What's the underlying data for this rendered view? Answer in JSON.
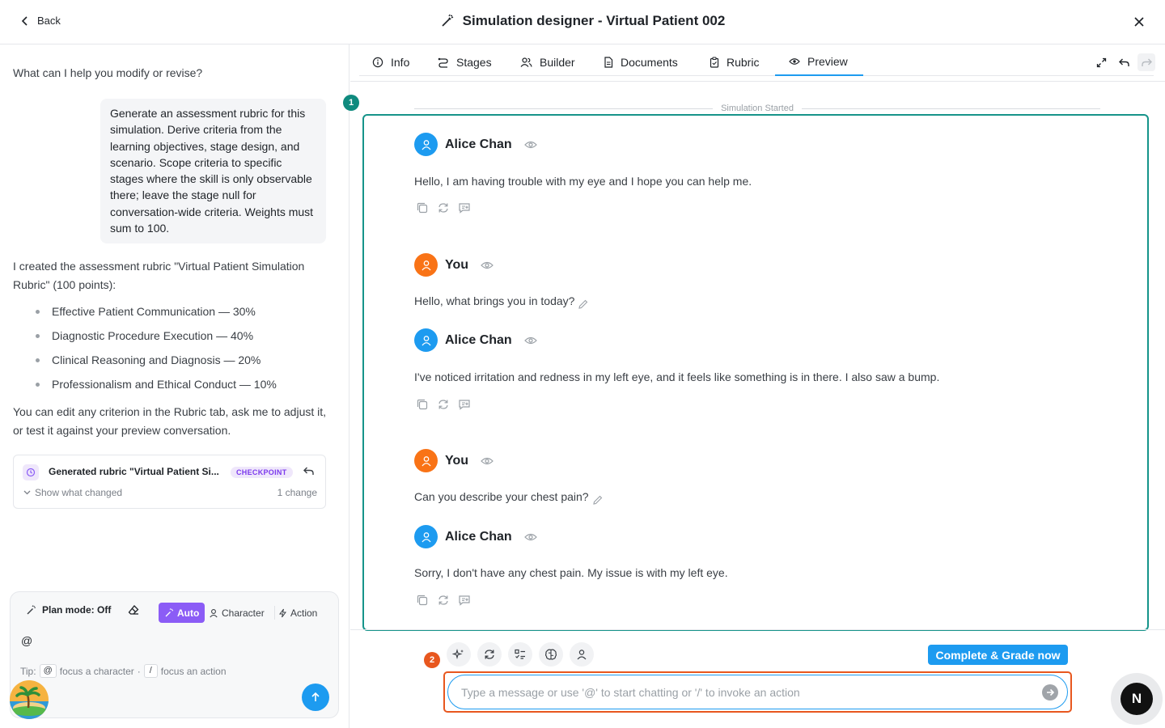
{
  "topbar": {
    "back_label": "Back",
    "title": "Simulation designer - Virtual Patient 002"
  },
  "left": {
    "question": "What can I help you modify or revise?",
    "user_prompt": "Generate an assessment rubric for this simulation. Derive criteria from the learning objectives, stage design, and scenario. Scope criteria to specific stages where the skill is only observable there; leave the stage null for conversation-wide criteria. Weights must sum to 100.",
    "reply_intro": "I created the assessment rubric \"Virtual Patient Simulation Rubric\" (100 points):",
    "criteria": [
      "Effective Patient Communication — 30%",
      "Diagnostic Procedure Execution — 40%",
      "Clinical Reasoning and Diagnosis — 20%",
      "Professionalism and Ethical Conduct — 10%"
    ],
    "reply_outro": "You can edit any criterion in the Rubric tab, ask me to adjust it, or test it against your preview conversation.",
    "checkpoint": {
      "title": "Generated rubric \"Virtual Patient Si...",
      "badge": "CHECKPOINT",
      "show_changed": "Show what changed",
      "change_count": "1 change"
    },
    "composer": {
      "plan_mode": "Plan mode: Off",
      "mode_auto": "Auto",
      "mode_character": "Character",
      "mode_action": "Action",
      "input_value": "@",
      "tip_prefix": "Tip:",
      "tip_key1": "@",
      "tip_text1": "focus a character",
      "tip_sep": "·",
      "tip_key2": "/",
      "tip_text2": "focus an action"
    }
  },
  "tabs": [
    {
      "label": "Info",
      "icon": "info-icon"
    },
    {
      "label": "Stages",
      "icon": "stages-icon"
    },
    {
      "label": "Builder",
      "icon": "users-icon"
    },
    {
      "label": "Documents",
      "icon": "document-icon"
    },
    {
      "label": "Rubric",
      "icon": "clipboard-icon"
    },
    {
      "label": "Preview",
      "icon": "eye-icon",
      "active": true
    }
  ],
  "preview": {
    "started_label": "Simulation Started",
    "marker1": "1",
    "marker2": "2",
    "messages": [
      {
        "sender": "Alice Chan",
        "role": "patient",
        "text": "Hello, I am having trouble with my eye and I hope you can help me."
      },
      {
        "sender": "You",
        "role": "user",
        "text": "Hello, what brings you in today?"
      },
      {
        "sender": "Alice Chan",
        "role": "patient",
        "text": "I've noticed irritation and redness in my left eye, and it feels like something is in there. I also saw a bump."
      },
      {
        "sender": "You",
        "role": "user",
        "text": "Can you describe your chest pain?"
      },
      {
        "sender": "Alice Chan",
        "role": "patient",
        "text": "Sorry, I don't have any chest pain. My issue is with my left eye."
      }
    ],
    "grade_button": "Complete & Grade now",
    "input_placeholder": "Type a message or use '@' to start chatting or '/' to invoke an action",
    "assistant_badge": "N"
  },
  "colors": {
    "accent": "#1d9bf0",
    "patient_avatar": "#1d9bf0",
    "user_avatar": "#f97316",
    "frame_teal": "#16948a",
    "frame_orange": "#e8571e",
    "mode_purple": "#8b5cf6"
  }
}
